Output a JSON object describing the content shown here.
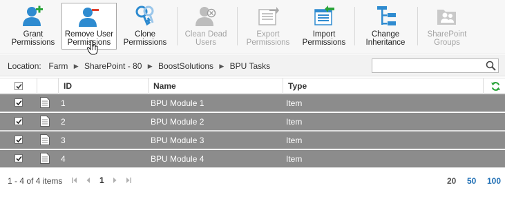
{
  "toolbar": {
    "buttons": [
      {
        "label": "Grant Permissions",
        "icon": "user-add-icon",
        "enabled": true
      },
      {
        "label": "Remove User Permissions",
        "icon": "user-remove-icon",
        "enabled": true
      },
      {
        "label": "Clone Permissions",
        "icon": "keys-icon",
        "enabled": true
      },
      {
        "label": "Clean Dead Users",
        "icon": "user-delete-icon",
        "enabled": false
      },
      {
        "label": "Export Permissions",
        "icon": "export-icon",
        "enabled": false
      },
      {
        "label": "Import Permissions",
        "icon": "import-icon",
        "enabled": true
      },
      {
        "label": "Change Inheritance",
        "icon": "inheritance-icon",
        "enabled": true
      },
      {
        "label": "SharePoint Groups",
        "icon": "group-folder-icon",
        "enabled": false
      }
    ]
  },
  "location": {
    "label": "Location:",
    "crumbs": [
      "Farm",
      "SharePoint - 80",
      "BoostSolutions",
      "BPU Tasks"
    ],
    "separator": "▶"
  },
  "search": {
    "value": "",
    "placeholder": ""
  },
  "grid": {
    "columns": [
      "ID",
      "Name",
      "Type"
    ],
    "rows": [
      {
        "id": "1",
        "name": "BPU Module 1",
        "type": "Item",
        "checked": true
      },
      {
        "id": "2",
        "name": "BPU Module 2",
        "type": "Item",
        "checked": true
      },
      {
        "id": "3",
        "name": "BPU Module 3",
        "type": "Item",
        "checked": true
      },
      {
        "id": "4",
        "name": "BPU Module 4",
        "type": "Item",
        "checked": true
      }
    ]
  },
  "pager": {
    "info": "1 - 4 of 4 items",
    "current_page": "1",
    "page_sizes": [
      "20",
      "50",
      "100"
    ]
  },
  "colors": {
    "selected_row": "#8c8c8c",
    "accent_blue": "#2e8bd0",
    "link_blue": "#1f6fb5",
    "disabled_gray": "#a3a3a3"
  }
}
